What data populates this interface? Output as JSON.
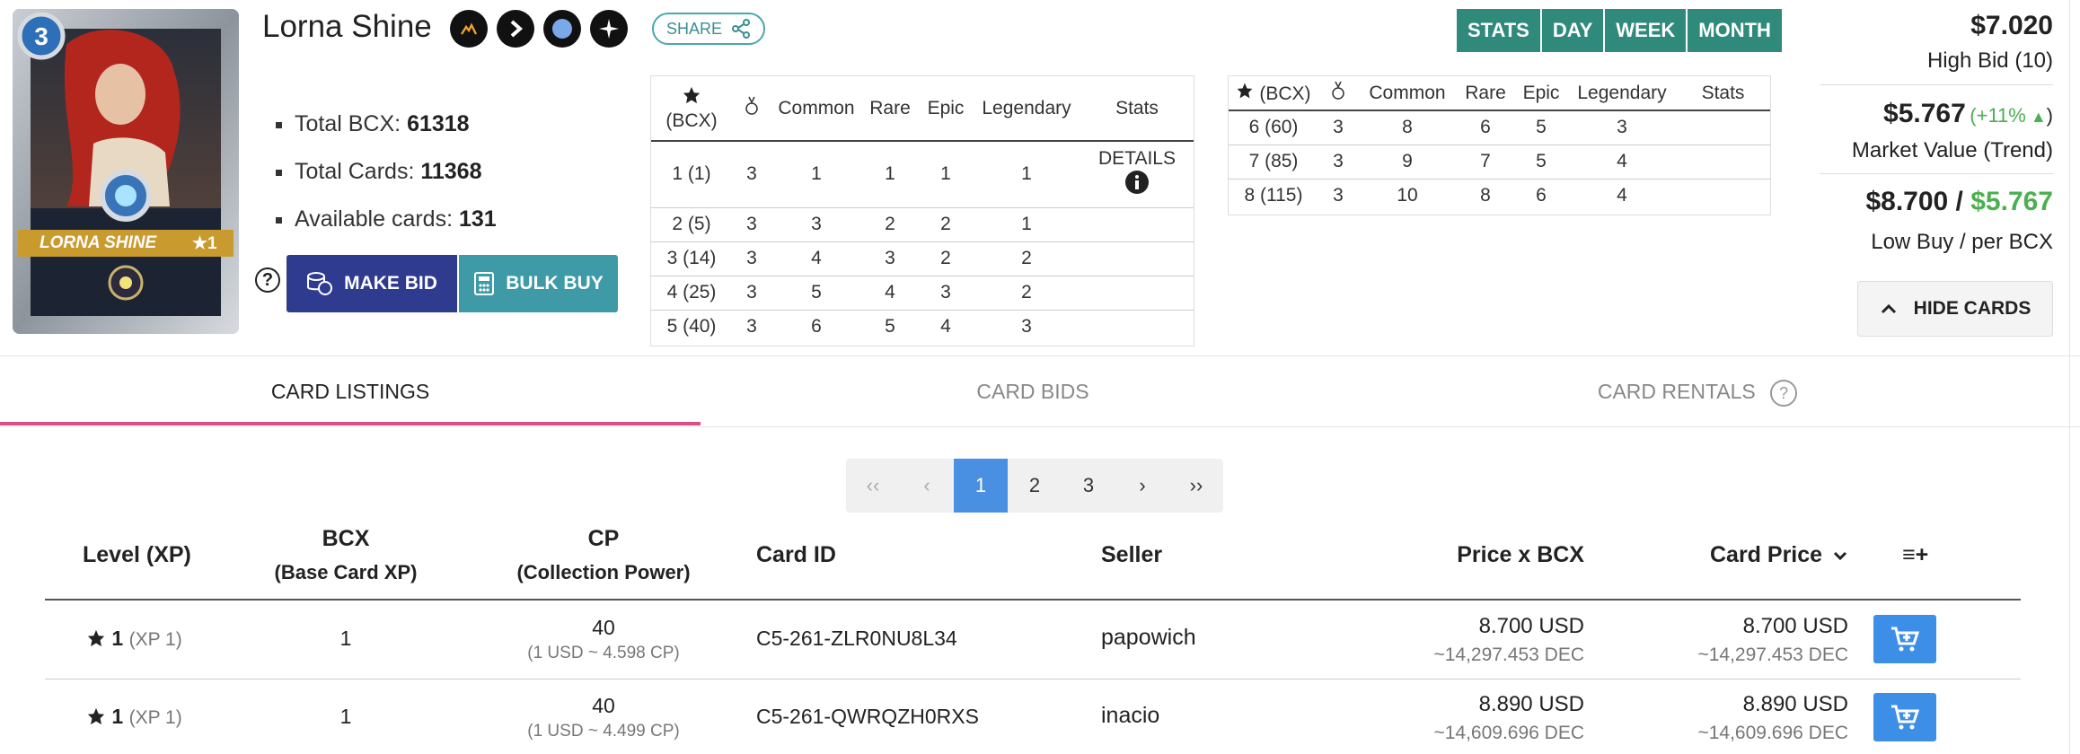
{
  "card": {
    "name": "Lorna Shine",
    "mana": "3",
    "banner_name": "LORNA SHINE",
    "banner_level": "★1"
  },
  "share_label": "SHARE",
  "stats_list": [
    {
      "label": "Total BCX: ",
      "value": "61318"
    },
    {
      "label": "Total Cards: ",
      "value": "11368"
    },
    {
      "label": "Available cards: ",
      "value": "131"
    }
  ],
  "buttons": {
    "make_bid": "MAKE BID",
    "bulk_buy": "BULK BUY",
    "help": "?"
  },
  "level_table_1": {
    "headers": [
      "(BCX)",
      "",
      "Common",
      "Rare",
      "Epic",
      "Legendary",
      "Stats"
    ],
    "rows": [
      [
        "1 (1)",
        "3",
        "1",
        "1",
        "1",
        "1"
      ],
      [
        "2 (5)",
        "3",
        "3",
        "2",
        "2",
        "1"
      ],
      [
        "3 (14)",
        "3",
        "4",
        "3",
        "2",
        "2"
      ],
      [
        "4 (25)",
        "3",
        "5",
        "4",
        "3",
        "2"
      ],
      [
        "5 (40)",
        "3",
        "6",
        "5",
        "4",
        "3"
      ]
    ],
    "details_label": "DETAILS"
  },
  "level_table_2": {
    "headers": [
      "(BCX)",
      "",
      "Common",
      "Rare",
      "Epic",
      "Legendary",
      "Stats"
    ],
    "rows": [
      [
        "6 (60)",
        "3",
        "8",
        "6",
        "5",
        "3"
      ],
      [
        "7 (85)",
        "3",
        "9",
        "7",
        "5",
        "4"
      ],
      [
        "8 (115)",
        "3",
        "10",
        "8",
        "6",
        "4"
      ]
    ]
  },
  "time_buttons": [
    "STATS",
    "DAY",
    "WEEK",
    "MONTH"
  ],
  "pricing": {
    "high_bid_price": "$7.020",
    "high_bid_label": "High Bid (10)",
    "market_value": "$5.767",
    "market_trend": "(+11%",
    "market_trend_close": ")",
    "market_label": "Market Value (Trend)",
    "low_buy": "$8.700 / ",
    "per_bcx": "$5.767",
    "low_buy_label": "Low Buy / per BCX"
  },
  "hide_cards_label": "HIDE CARDS",
  "tabs": [
    "CARD LISTINGS",
    "CARD BIDS",
    "CARD RENTALS"
  ],
  "tab_help": "?",
  "pager": [
    "‹‹",
    "‹",
    "1",
    "2",
    "3",
    "›",
    "››"
  ],
  "listing_headers": {
    "level": "Level (XP)",
    "bcx": "BCX",
    "bcx_sub": "(Base Card XP)",
    "cp": "CP",
    "cp_sub": "(Collection Power)",
    "card_id": "Card ID",
    "seller": "Seller",
    "price_bcx": "Price x BCX",
    "card_price": "Card Price",
    "columns_icon": "≡+"
  },
  "listings": [
    {
      "level": "1",
      "xp": "(XP 1)",
      "bcx": "1",
      "cp": "40",
      "cp_sub": "(1 USD ~ 4.598 CP)",
      "card_id": "C5-261-ZLR0NU8L34",
      "seller": "papowich",
      "price_bcx": "8.700 USD",
      "price_bcx_dec": "~14,297.453 DEC",
      "card_price": "8.700 USD",
      "card_price_dec": "~14,297.453 DEC"
    },
    {
      "level": "1",
      "xp": "(XP 1)",
      "bcx": "1",
      "cp": "40",
      "cp_sub": "(1 USD ~ 4.499 CP)",
      "card_id": "C5-261-QWRQZH0RXS",
      "seller": "inacio",
      "price_bcx": "8.890 USD",
      "price_bcx_dec": "~14,609.696 DEC",
      "card_price": "8.890 USD",
      "card_price_dec": "~14,609.696 DEC"
    }
  ],
  "colors": {
    "accent_pink": "#d94f84",
    "teal": "#2f8a7c",
    "blue": "#3d8ee6",
    "navy": "#2e3b8f",
    "green": "#4caf50"
  }
}
